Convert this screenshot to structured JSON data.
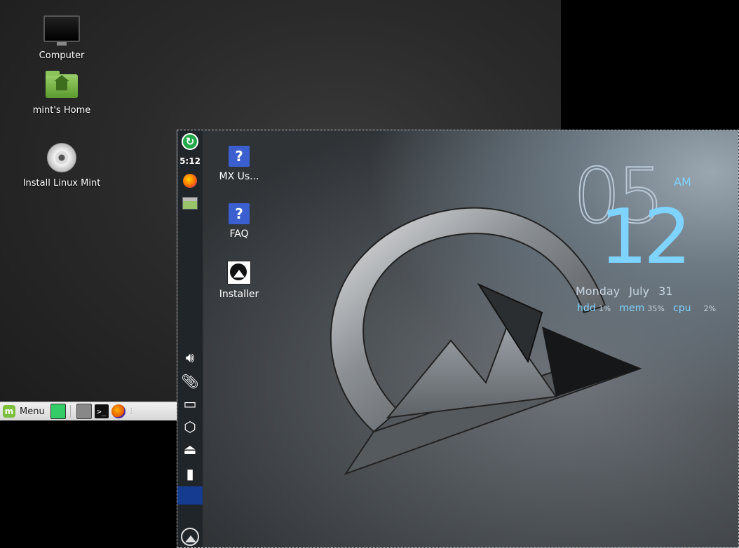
{
  "mint": {
    "desktop_icons": [
      {
        "label": "Computer"
      },
      {
        "label": "mint's Home"
      },
      {
        "label": "Install Linux Mint"
      }
    ],
    "panel": {
      "menu_label": "Menu"
    }
  },
  "mx": {
    "panel": {
      "clock": "5:12"
    },
    "desktop_icons": [
      {
        "label": "MX Us..."
      },
      {
        "label": "FAQ"
      },
      {
        "label": "Installer"
      }
    ],
    "conky": {
      "hour": "05",
      "minute": "12",
      "ampm": "AM",
      "day": "Monday",
      "date": "July 31",
      "stats": [
        {
          "label": "hdd",
          "value": "1%"
        },
        {
          "label": "mem",
          "value": "35%"
        },
        {
          "label": "cpu",
          "value": "2%"
        }
      ]
    }
  },
  "colors": {
    "conky_accent": "#7ed3ff",
    "mx_workspace": "#143b8f",
    "mint_green": "#7cbf3a"
  }
}
